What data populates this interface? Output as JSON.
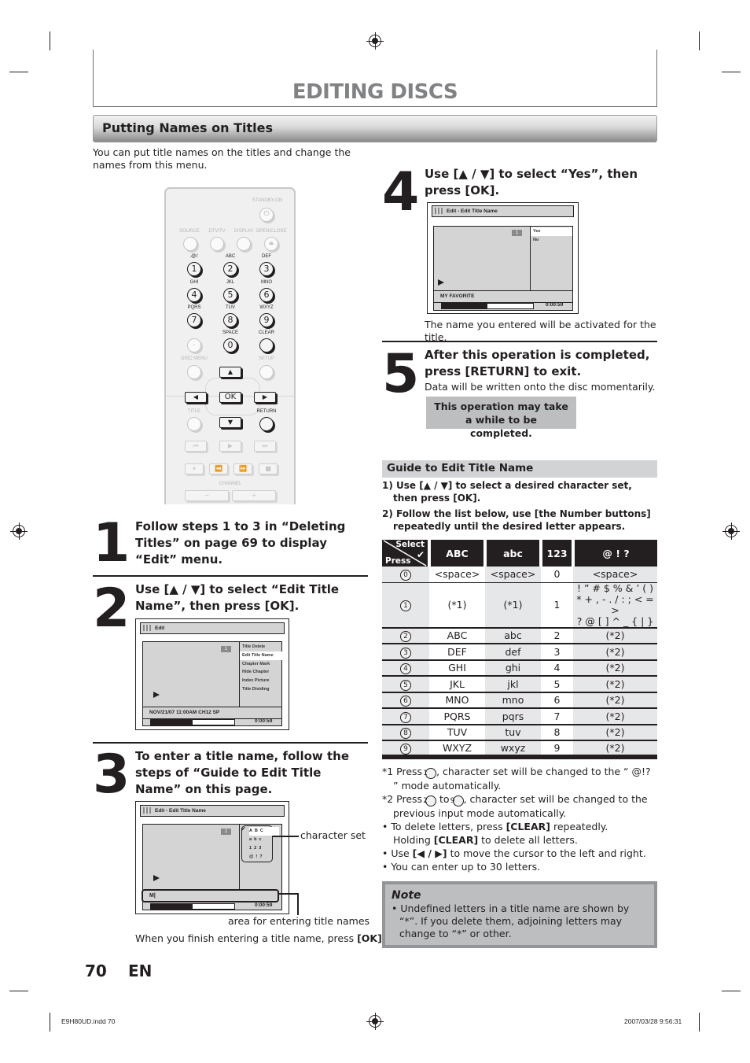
{
  "page": {
    "title": "EDITING DISCS",
    "section": "Putting Names on Titles",
    "intro": "You can put title names on the titles and change the names from this menu.",
    "page_number": "70",
    "language": "EN",
    "slug_left": "E9H80UD.indd   70",
    "slug_right": "2007/03/28   9:56:31"
  },
  "remote": {
    "labels": {
      "standby": "STANDBY-ON",
      "source": "SOURCE",
      "dtvtv": "DTV/TV",
      "display": "DISPLAY",
      "openclose": "OPEN/CLOSE",
      "k1": ".@/:",
      "k2": "ABC",
      "k3": "DEF",
      "k4": "GHI",
      "k5": "JKL",
      "k6": "MNO",
      "k7": "PQRS",
      "k8": "TUV",
      "k9": "WXYZ",
      "k0": "SPACE",
      "clear": "CLEAR",
      "discmenu": "DISC MENU",
      "setup": "SETUP",
      "title": "TITLE",
      "return": "RETURN",
      "channel": "CHANNEL"
    },
    "keys": [
      "1",
      "2",
      "3",
      "4",
      "5",
      "6",
      "7",
      "8",
      "9",
      "0"
    ],
    "ok": "OK",
    "dot": "·",
    "minus": "−",
    "plus": "+"
  },
  "steps": [
    {
      "num": "1",
      "text": "Follow steps 1 to 3 in “Deleting Titles” on page 69 to display “Edit” menu."
    },
    {
      "num": "2",
      "text": "Use [▲ / ▼] to select “Edit Title Name”, then press [OK]."
    },
    {
      "num": "3",
      "text": "To enter a title name, follow the steps of “Guide to Edit Title Name” on this page."
    },
    {
      "num": "4",
      "text": "Use [▲ / ▼] to select “Yes”, then press [OK]."
    },
    {
      "num": "5",
      "text": "After this operation is completed, press [RETURN] to exit."
    }
  ],
  "screen_edit": {
    "header": "Edit",
    "badge": "1",
    "menu": [
      "Title Delete",
      "Edit Title Name",
      "Chapter Mark",
      "Hide Chapter",
      "Index Picture",
      "Title Dividing"
    ],
    "selected_index": 1,
    "info": "NOV/21/07 11:00AM CH12 SP",
    "progress": 0.5,
    "time": "0:00:59"
  },
  "screen_name": {
    "header": "Edit - Edit Title Name",
    "badge": "1",
    "charsets": [
      [
        "A",
        "B",
        "C"
      ],
      [
        "a",
        "b",
        "c"
      ],
      [
        "1",
        "2",
        "3"
      ],
      [
        "@",
        "!",
        "?"
      ]
    ],
    "input": "M|",
    "progress": 0.5,
    "time": "0:00:59",
    "callout_charset": "character set",
    "callout_area": "area for entering title names",
    "after_text": "When you finish entering a title name, press ",
    "after_key": "[OK]",
    "after_end": "."
  },
  "screen_yes": {
    "header": "Edit - Edit Title Name",
    "badge": "1",
    "options": [
      "Yes",
      "No"
    ],
    "selected_index": 0,
    "info": "MY FAVORITE",
    "progress": 0.5,
    "time": "0:00:59",
    "caption": "The name you entered will be activated for the title."
  },
  "step5": {
    "body": "Data will be written onto the disc momentarily.",
    "box": "This operation may take a while to be completed."
  },
  "guide": {
    "title": "Guide to Edit Title Name",
    "items": [
      "1) Use [▲ / ▼] to select a desired character set, then press [OK].",
      "2) Follow the list below, use [the Number buttons] repeatedly until the desired letter appears."
    ],
    "table": {
      "corner_select": "Select",
      "corner_press": "Press",
      "headers": [
        "ABC",
        "abc",
        "123",
        "@ ! ?"
      ],
      "rows": [
        {
          "key": "0",
          "cells": [
            "<space>",
            "<space>",
            "0",
            "<space>"
          ]
        },
        {
          "key": "1",
          "cells": [
            "(*1)",
            "(*1)",
            "1",
            "! ” # $ % & ’ ( )\n* + , - . / : ; < = >\n? @ [ ] ^ _ { | }"
          ]
        },
        {
          "key": "2",
          "cells": [
            "ABC",
            "abc",
            "2",
            "(*2)"
          ]
        },
        {
          "key": "3",
          "cells": [
            "DEF",
            "def",
            "3",
            "(*2)"
          ]
        },
        {
          "key": "4",
          "cells": [
            "GHI",
            "ghi",
            "4",
            "(*2)"
          ]
        },
        {
          "key": "5",
          "cells": [
            "JKL",
            "jkl",
            "5",
            "(*2)"
          ]
        },
        {
          "key": "6",
          "cells": [
            "MNO",
            "mno",
            "6",
            "(*2)"
          ]
        },
        {
          "key": "7",
          "cells": [
            "PQRS",
            "pqrs",
            "7",
            "(*2)"
          ]
        },
        {
          "key": "8",
          "cells": [
            "TUV",
            "tuv",
            "8",
            "(*2)"
          ]
        },
        {
          "key": "9",
          "cells": [
            "WXYZ",
            "wxyz",
            "9",
            "(*2)"
          ]
        }
      ]
    },
    "footnotes": {
      "f1_a": "*1 Press ",
      "f1_key": "1",
      "f1_b": ", character set will be changed to the “ @!? ” mode automatically.",
      "f2_a": "*2 Press ",
      "f2_key1": "2",
      "f2_mid": " to ",
      "f2_key2": "9",
      "f2_b": ", character set will be changed to the previous input mode automatically.",
      "b1_a": "• To delete letters, press ",
      "b1_key": "[CLEAR]",
      "b1_b": " repeatedly.",
      "b1_c": "Holding ",
      "b1_key2": "[CLEAR]",
      "b1_d": " to delete all letters.",
      "b2_a": "• Use ",
      "b2_key": "[◀ / ▶]",
      "b2_b": " to move the cursor to the left and right.",
      "b3": "• You can enter up to 30 letters."
    }
  },
  "note": {
    "title": "Note",
    "text": "• Undefined letters in a title name are shown by “*”. If you delete them, adjoining letters may change to “*” or other."
  }
}
